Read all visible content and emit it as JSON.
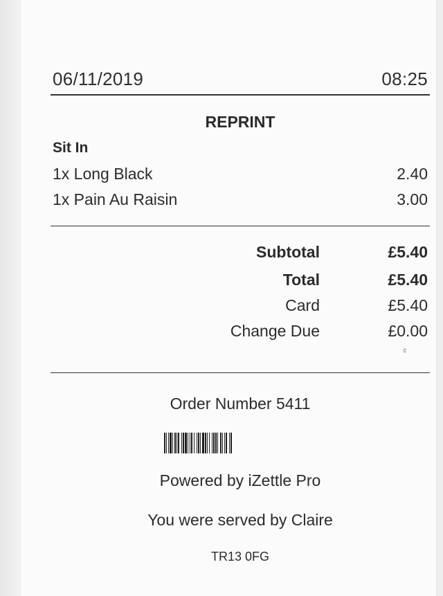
{
  "receipt": {
    "date": "06/11/2019",
    "time": "08:25",
    "heading": "REPRINT",
    "order_type": "Sit In",
    "items": [
      {
        "name": "1x Long Black",
        "price": "2.40"
      },
      {
        "name": "1x Pain Au Raisin",
        "price": "3.00"
      }
    ],
    "totals": [
      {
        "label": "Subtotal",
        "value": "£5.40"
      },
      {
        "label": "Total",
        "value": "£5.40"
      },
      {
        "label": "Card",
        "value": "£5.40"
      },
      {
        "label": "Change Due",
        "value": "£0.00"
      }
    ],
    "order_number": "Order Number 5411",
    "powered_by": "Powered by iZettle Pro",
    "served_by": "You were served by Claire",
    "postcode": "TR13 0FG"
  },
  "colors": {
    "ink": "#2b2b2b",
    "paper": "#fbfbfb",
    "background": "#eeeeee"
  }
}
